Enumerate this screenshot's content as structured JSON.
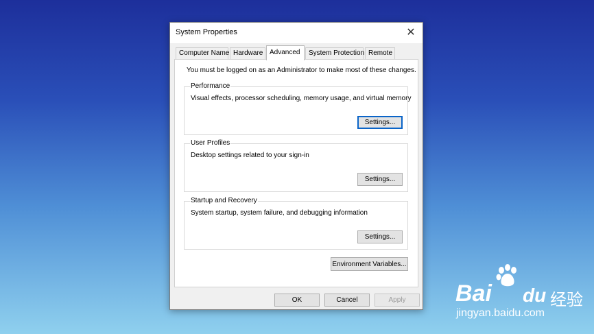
{
  "dialog": {
    "title": "System Properties",
    "close_glyph": "✕",
    "tabs": [
      {
        "label": "Computer Name"
      },
      {
        "label": "Hardware"
      },
      {
        "label": "Advanced"
      },
      {
        "label": "System Protection"
      },
      {
        "label": "Remote"
      }
    ],
    "active_tab": "Advanced",
    "notice": "You must be logged on as an Administrator to make most of these changes.",
    "performance": {
      "label": "Performance",
      "description": "Visual effects, processor scheduling, memory usage, and virtual memory",
      "button": "Settings..."
    },
    "user_profiles": {
      "label": "User Profiles",
      "description": "Desktop settings related to your sign-in",
      "button": "Settings..."
    },
    "startup_recovery": {
      "label": "Startup and Recovery",
      "description": "System startup, system failure, and debugging information",
      "button": "Settings..."
    },
    "env_button": "Environment Variables...",
    "footer": {
      "ok": "OK",
      "cancel": "Cancel",
      "apply": "Apply"
    }
  },
  "watermark": {
    "brand": "Bai",
    "brand_suffix": "du",
    "cn": "经验",
    "url": "jingyan.baidu.com"
  },
  "colors": {
    "focus_border": "#0a64c8",
    "desktop_top": "#1d2f9b",
    "desktop_bottom": "#8fd0ee"
  }
}
